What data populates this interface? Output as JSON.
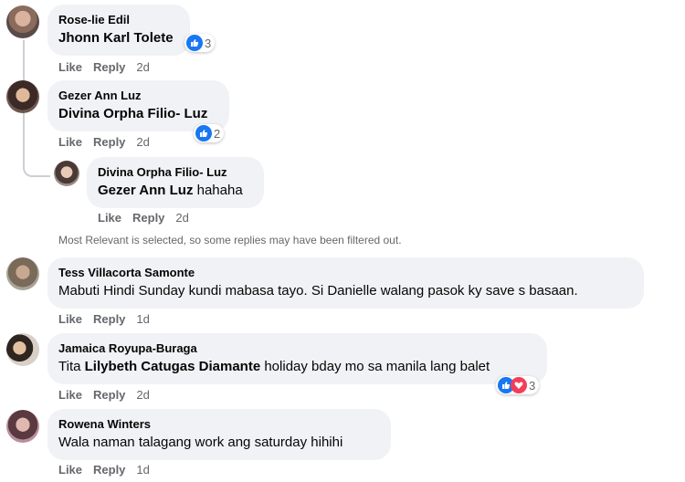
{
  "colors": {
    "like_blue": "#1877f2",
    "love_red": "#f33e58",
    "bubble_bg": "#f0f2f5",
    "muted_text": "#65676b"
  },
  "actions": {
    "like": "Like",
    "reply": "Reply"
  },
  "comments": [
    {
      "author": "Rose-lie Edil",
      "tag": "Jhonn Karl Tolete",
      "text": "",
      "reaction_count": "3",
      "time": "2d"
    },
    {
      "author": "Gezer Ann Luz",
      "tag": "Divina Orpha Filio- Luz",
      "text": "",
      "reaction_count": "2",
      "time": "2d",
      "reply": {
        "author": "Divina Orpha Filio- Luz",
        "tag": "Gezer Ann Luz",
        "text": " hahaha",
        "time": "2d"
      }
    },
    {
      "author": "Tess Villacorta Samonte",
      "text": "Mabuti Hindi Sunday kundi mabasa tayo. Si Danielle walang pasok ky save s basaan.",
      "time": "1d"
    },
    {
      "author": "Jamaica Royupa-Buraga",
      "pre": "Tita ",
      "tag": "Lilybeth Catugas Diamante",
      "text": " holiday bday mo sa manila lang balet",
      "reaction_count": "3",
      "time": "2d"
    },
    {
      "author": "Rowena Winters",
      "text": "Wala naman talagang work ang saturday hihihi",
      "time": "1d"
    }
  ],
  "notice": "Most Relevant is selected, so some replies may have been filtered out."
}
